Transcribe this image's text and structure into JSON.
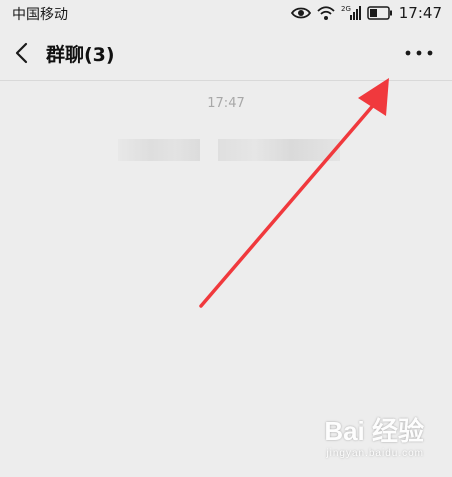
{
  "status_bar": {
    "carrier": "中国移动",
    "network": "2G",
    "time": "17:47",
    "icons": [
      "eye-icon",
      "wifi-icon",
      "signal-icon",
      "battery-icon"
    ]
  },
  "header": {
    "title": "群聊(3)",
    "back_icon": "chevron-left-icon",
    "more_icon": "more-dots-icon"
  },
  "chat": {
    "timestamp": "17:47"
  },
  "watermark": {
    "logo": "Bai 经验",
    "sub": "jingyan.baidu.com"
  },
  "colors": {
    "background": "#ededed",
    "arrow": "#f0393d"
  }
}
